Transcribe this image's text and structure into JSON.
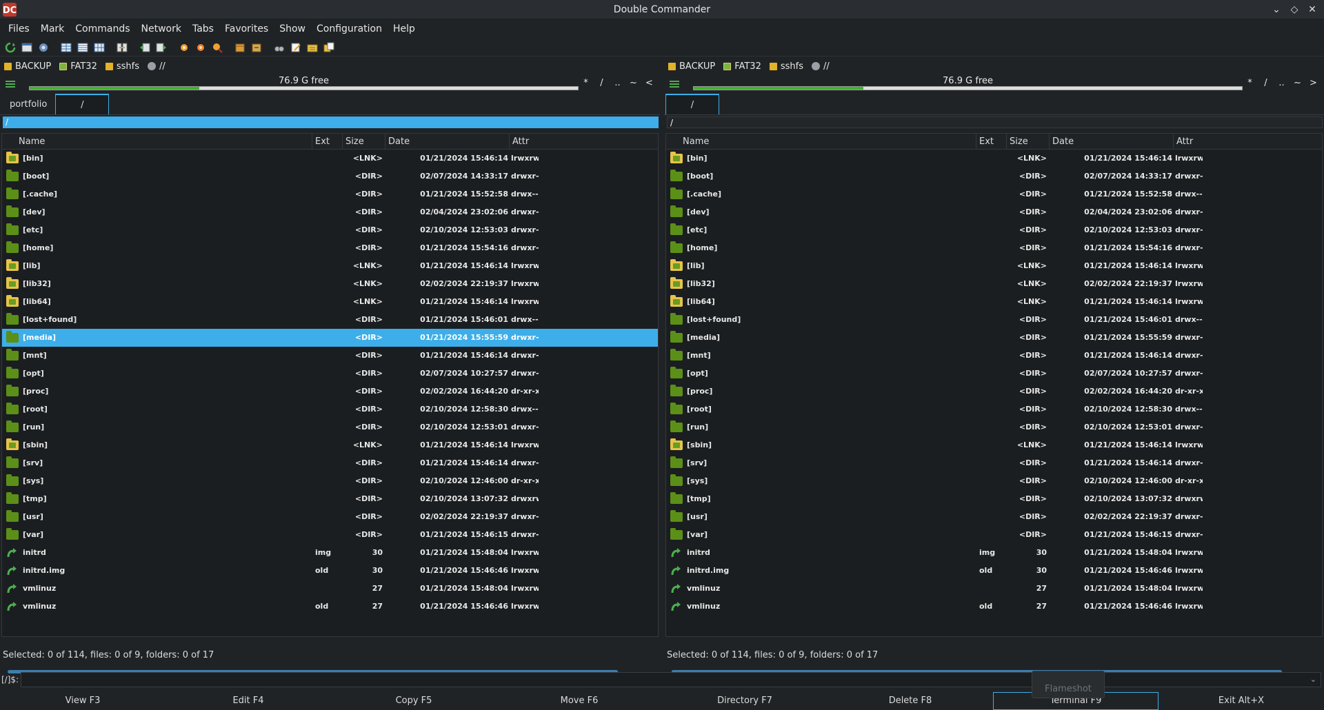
{
  "window": {
    "title": "Double Commander"
  },
  "menu": [
    "Files",
    "Mark",
    "Commands",
    "Network",
    "Tabs",
    "Favorites",
    "Show",
    "Configuration",
    "Help"
  ],
  "toolbar_icons": [
    "refresh-icon",
    "terminal-icon",
    "options-icon",
    "brief-view-icon",
    "full-view-icon",
    "thumbnail-view-icon",
    "swap-panels-icon",
    "backward-icon",
    "forward-icon",
    "search-icon",
    "search-files-icon",
    "multi-rename-icon",
    "pack-icon",
    "unpack-icon",
    "compare-icon",
    "edit-icon",
    "new-folder-icon",
    "copy-names-icon"
  ],
  "drives": [
    {
      "label": "BACKUP",
      "type": "usb"
    },
    {
      "label": "FAT32",
      "type": "hdd"
    },
    {
      "label": "sshfs",
      "type": "hdd"
    },
    {
      "label": "//",
      "type": "net"
    }
  ],
  "left": {
    "free_text": "76.9 G free",
    "used_fraction": 0.31,
    "nav": [
      "*",
      "/",
      "..",
      "~",
      "<"
    ],
    "tabs": [
      {
        "label": "portfolio",
        "active": false
      },
      {
        "label": "/",
        "active": true
      }
    ],
    "path": "/",
    "columns": [
      "Name",
      "Ext",
      "Size",
      "Date",
      "Attr"
    ],
    "status": "Selected: 0 of 114, files: 0 of 9, folders: 0 of 17"
  },
  "right": {
    "free_text": "76.9 G free",
    "used_fraction": 0.31,
    "nav": [
      "*",
      "/",
      "..",
      "~",
      ">"
    ],
    "tabs": [
      {
        "label": "/",
        "active": true
      }
    ],
    "path": "/",
    "columns": [
      "Name",
      "Ext",
      "Size",
      "Date",
      "Attr"
    ],
    "status": "Selected: 0 of 114, files: 0 of 9, folders: 0 of 17"
  },
  "files": [
    {
      "name": "[bin]",
      "ext": "",
      "size": "<LNK>",
      "date": "01/21/2024 15:46:14",
      "attr": "lrwxrwx",
      "kind": "lnkdir"
    },
    {
      "name": "[boot]",
      "ext": "",
      "size": "<DIR>",
      "date": "02/07/2024 14:33:17",
      "attr": "drwxr-x",
      "kind": "dir"
    },
    {
      "name": "[.cache]",
      "ext": "",
      "size": "<DIR>",
      "date": "01/21/2024 15:52:58",
      "attr": "drwx---",
      "kind": "dir"
    },
    {
      "name": "[dev]",
      "ext": "",
      "size": "<DIR>",
      "date": "02/04/2024 23:02:06",
      "attr": "drwxr-x",
      "kind": "dir"
    },
    {
      "name": "[etc]",
      "ext": "",
      "size": "<DIR>",
      "date": "02/10/2024 12:53:03",
      "attr": "drwxr-x",
      "kind": "dir"
    },
    {
      "name": "[home]",
      "ext": "",
      "size": "<DIR>",
      "date": "01/21/2024 15:54:16",
      "attr": "drwxr-x",
      "kind": "dir"
    },
    {
      "name": "[lib]",
      "ext": "",
      "size": "<LNK>",
      "date": "01/21/2024 15:46:14",
      "attr": "lrwxrwx",
      "kind": "lnkdir"
    },
    {
      "name": "[lib32]",
      "ext": "",
      "size": "<LNK>",
      "date": "02/02/2024 22:19:37",
      "attr": "lrwxrwx",
      "kind": "lnkdir"
    },
    {
      "name": "[lib64]",
      "ext": "",
      "size": "<LNK>",
      "date": "01/21/2024 15:46:14",
      "attr": "lrwxrwx",
      "kind": "lnkdir"
    },
    {
      "name": "[lost+found]",
      "ext": "",
      "size": "<DIR>",
      "date": "01/21/2024 15:46:01",
      "attr": "drwx---",
      "kind": "dir"
    },
    {
      "name": "[media]",
      "ext": "",
      "size": "<DIR>",
      "date": "01/21/2024 15:55:59",
      "attr": "drwxr-x",
      "kind": "dir"
    },
    {
      "name": "[mnt]",
      "ext": "",
      "size": "<DIR>",
      "date": "01/21/2024 15:46:14",
      "attr": "drwxr-x",
      "kind": "dir"
    },
    {
      "name": "[opt]",
      "ext": "",
      "size": "<DIR>",
      "date": "02/07/2024 10:27:57",
      "attr": "drwxr-x",
      "kind": "dir"
    },
    {
      "name": "[proc]",
      "ext": "",
      "size": "<DIR>",
      "date": "02/02/2024 16:44:20",
      "attr": "dr-xr-xr",
      "kind": "dir"
    },
    {
      "name": "[root]",
      "ext": "",
      "size": "<DIR>",
      "date": "02/10/2024 12:58:30",
      "attr": "drwx---",
      "kind": "dir"
    },
    {
      "name": "[run]",
      "ext": "",
      "size": "<DIR>",
      "date": "02/10/2024 12:53:01",
      "attr": "drwxr-x",
      "kind": "dir"
    },
    {
      "name": "[sbin]",
      "ext": "",
      "size": "<LNK>",
      "date": "01/21/2024 15:46:14",
      "attr": "lrwxrwx",
      "kind": "lnkdir"
    },
    {
      "name": "[srv]",
      "ext": "",
      "size": "<DIR>",
      "date": "01/21/2024 15:46:14",
      "attr": "drwxr-x",
      "kind": "dir"
    },
    {
      "name": "[sys]",
      "ext": "",
      "size": "<DIR>",
      "date": "02/10/2024 12:46:00",
      "attr": "dr-xr-xr",
      "kind": "dir"
    },
    {
      "name": "[tmp]",
      "ext": "",
      "size": "<DIR>",
      "date": "02/10/2024 13:07:32",
      "attr": "drwxrwx",
      "kind": "dir"
    },
    {
      "name": "[usr]",
      "ext": "",
      "size": "<DIR>",
      "date": "02/02/2024 22:19:37",
      "attr": "drwxr-x",
      "kind": "dir"
    },
    {
      "name": "[var]",
      "ext": "",
      "size": "<DIR>",
      "date": "01/21/2024 15:46:15",
      "attr": "drwxr-x",
      "kind": "dir"
    },
    {
      "name": "initrd",
      "ext": "img",
      "size": "30",
      "date": "01/21/2024 15:48:04",
      "attr": "lrwxrwx",
      "kind": "link"
    },
    {
      "name": "initrd.img",
      "ext": "old",
      "size": "30",
      "date": "01/21/2024 15:46:46",
      "attr": "lrwxrwx",
      "kind": "link"
    },
    {
      "name": "vmlinuz",
      "ext": "",
      "size": "27",
      "date": "01/21/2024 15:48:04",
      "attr": "lrwxrwx",
      "kind": "link"
    },
    {
      "name": "vmlinuz",
      "ext": "old",
      "size": "27",
      "date": "01/21/2024 15:46:46",
      "attr": "lrwxrwx",
      "kind": "link"
    }
  ],
  "left_selected_index": 10,
  "cmdline": {
    "prompt": "[/]$:",
    "value": ""
  },
  "fkeys": [
    "View F3",
    "Edit F4",
    "Copy F5",
    "Move F6",
    "Directory F7",
    "Delete F8",
    "Terminal F9",
    "Exit Alt+X"
  ],
  "overlay": {
    "label": "Flameshot"
  },
  "colors": {
    "accent": "#3daee9",
    "background": "#202326",
    "list_bg": "#1b1e20",
    "folder": "#5b8f17",
    "link_folder": "#e6c34a",
    "free_bar": "#3fb42a"
  }
}
